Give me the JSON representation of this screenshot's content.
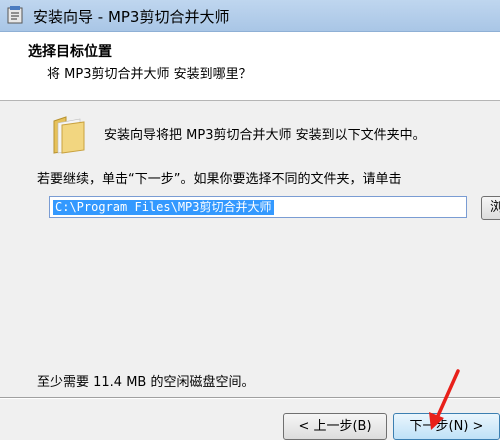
{
  "window": {
    "title": "安装向导 - MP3剪切合并大师"
  },
  "header": {
    "title": "选择目标位置",
    "subtitle": "将 MP3剪切合并大师 安装到哪里？"
  },
  "main": {
    "intro": "安装向导将把 MP3剪切合并大师 安装到以下文件夹中。",
    "instruction": "若要继续，单击“下一步”。如果你要选择不同的文件夹，请单击",
    "path_value": "C:\\Program Files\\MP3剪切合并大师",
    "browse_label": "浏",
    "space_required": "至少需要 11.4 MB 的空闲磁盘空间。"
  },
  "footer": {
    "back_label": "< 上一步(B)",
    "next_label": "下一步(N) >"
  },
  "colors": {
    "accent": "#3399ff",
    "annotation_arrow": "#e8201a"
  },
  "icons": [
    "setup-app-icon",
    "folder-icon",
    "red-arrow-annotation"
  ]
}
